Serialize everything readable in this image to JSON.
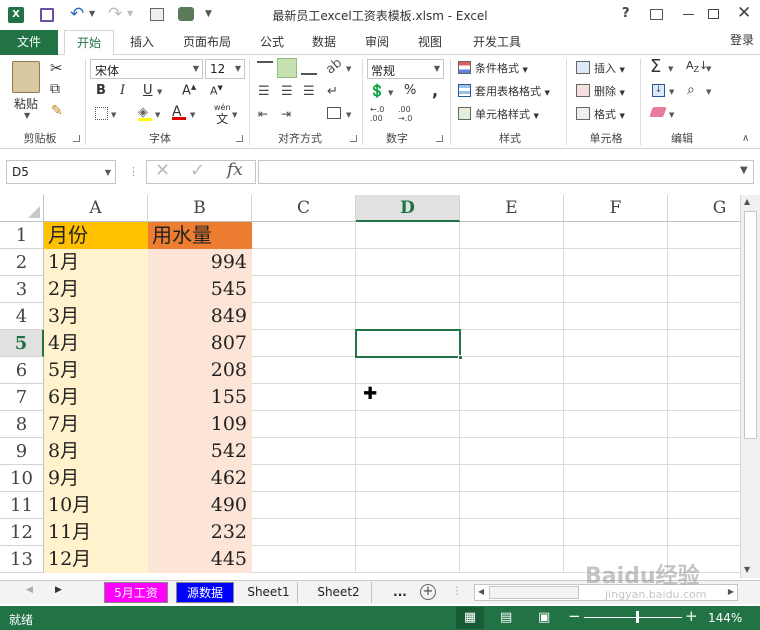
{
  "window": {
    "title": "最新员工excel工资表模板.xlsm - Excel",
    "help": "?",
    "signin": "登录"
  },
  "ribbon_tabs": [
    "文件",
    "开始",
    "插入",
    "页面布局",
    "公式",
    "数据",
    "审阅",
    "视图",
    "开发工具"
  ],
  "ribbon": {
    "clipboard": {
      "paste": "粘贴",
      "label": "剪贴板"
    },
    "font": {
      "name": "宋体",
      "size": "12",
      "bold": "B",
      "italic": "I",
      "underline": "U",
      "label": "字体",
      "wen": "wén",
      "wen_char": "文"
    },
    "alignment": {
      "label": "对齐方式"
    },
    "number": {
      "format": "常规",
      "percent": "%",
      "comma": ",",
      "inc": "←.0\n.00",
      "dec": ".00\n→.0",
      "label": "数字"
    },
    "styles": {
      "cond": "条件格式",
      "table": "套用表格格式",
      "cell": "单元格样式",
      "label": "样式"
    },
    "cells": {
      "insert": "插入",
      "delete": "删除",
      "format": "格式",
      "label": "单元格"
    },
    "editing": {
      "label": "编辑"
    }
  },
  "formula_bar": {
    "name_box": "D5",
    "fx": "fx",
    "content": ""
  },
  "columns": [
    "A",
    "B",
    "C",
    "D",
    "E",
    "F",
    "G"
  ],
  "rows": [
    "1",
    "2",
    "3",
    "4",
    "5",
    "6",
    "7",
    "8",
    "9",
    "10",
    "11",
    "12",
    "13"
  ],
  "table": {
    "header": [
      "月份",
      "用水量"
    ],
    "data": [
      [
        "1月",
        "994"
      ],
      [
        "2月",
        "545"
      ],
      [
        "3月",
        "849"
      ],
      [
        "4月",
        "807"
      ],
      [
        "5月",
        "208"
      ],
      [
        "6月",
        "155"
      ],
      [
        "7月",
        "109"
      ],
      [
        "8月",
        "542"
      ],
      [
        "9月",
        "462"
      ],
      [
        "10月",
        "490"
      ],
      [
        "11月",
        "232"
      ],
      [
        "12月",
        "445"
      ]
    ]
  },
  "sheet_tabs": [
    "5月工资",
    "源数据",
    "Sheet1",
    "Sheet2"
  ],
  "sheet_more": "...",
  "status": {
    "ready": "就绪",
    "zoom": "144%"
  },
  "watermark": {
    "text": "Baidu经验",
    "sub": "jingyan.baidu.com"
  },
  "colors": {
    "excel_green": "#217346",
    "header_a": "#FFC000",
    "header_b": "#ED7D31",
    "fill_a": "#FFF2CC",
    "fill_b": "#FCE4D6",
    "tab_magenta": "#FF00FF",
    "tab_blue": "#0000FF"
  }
}
